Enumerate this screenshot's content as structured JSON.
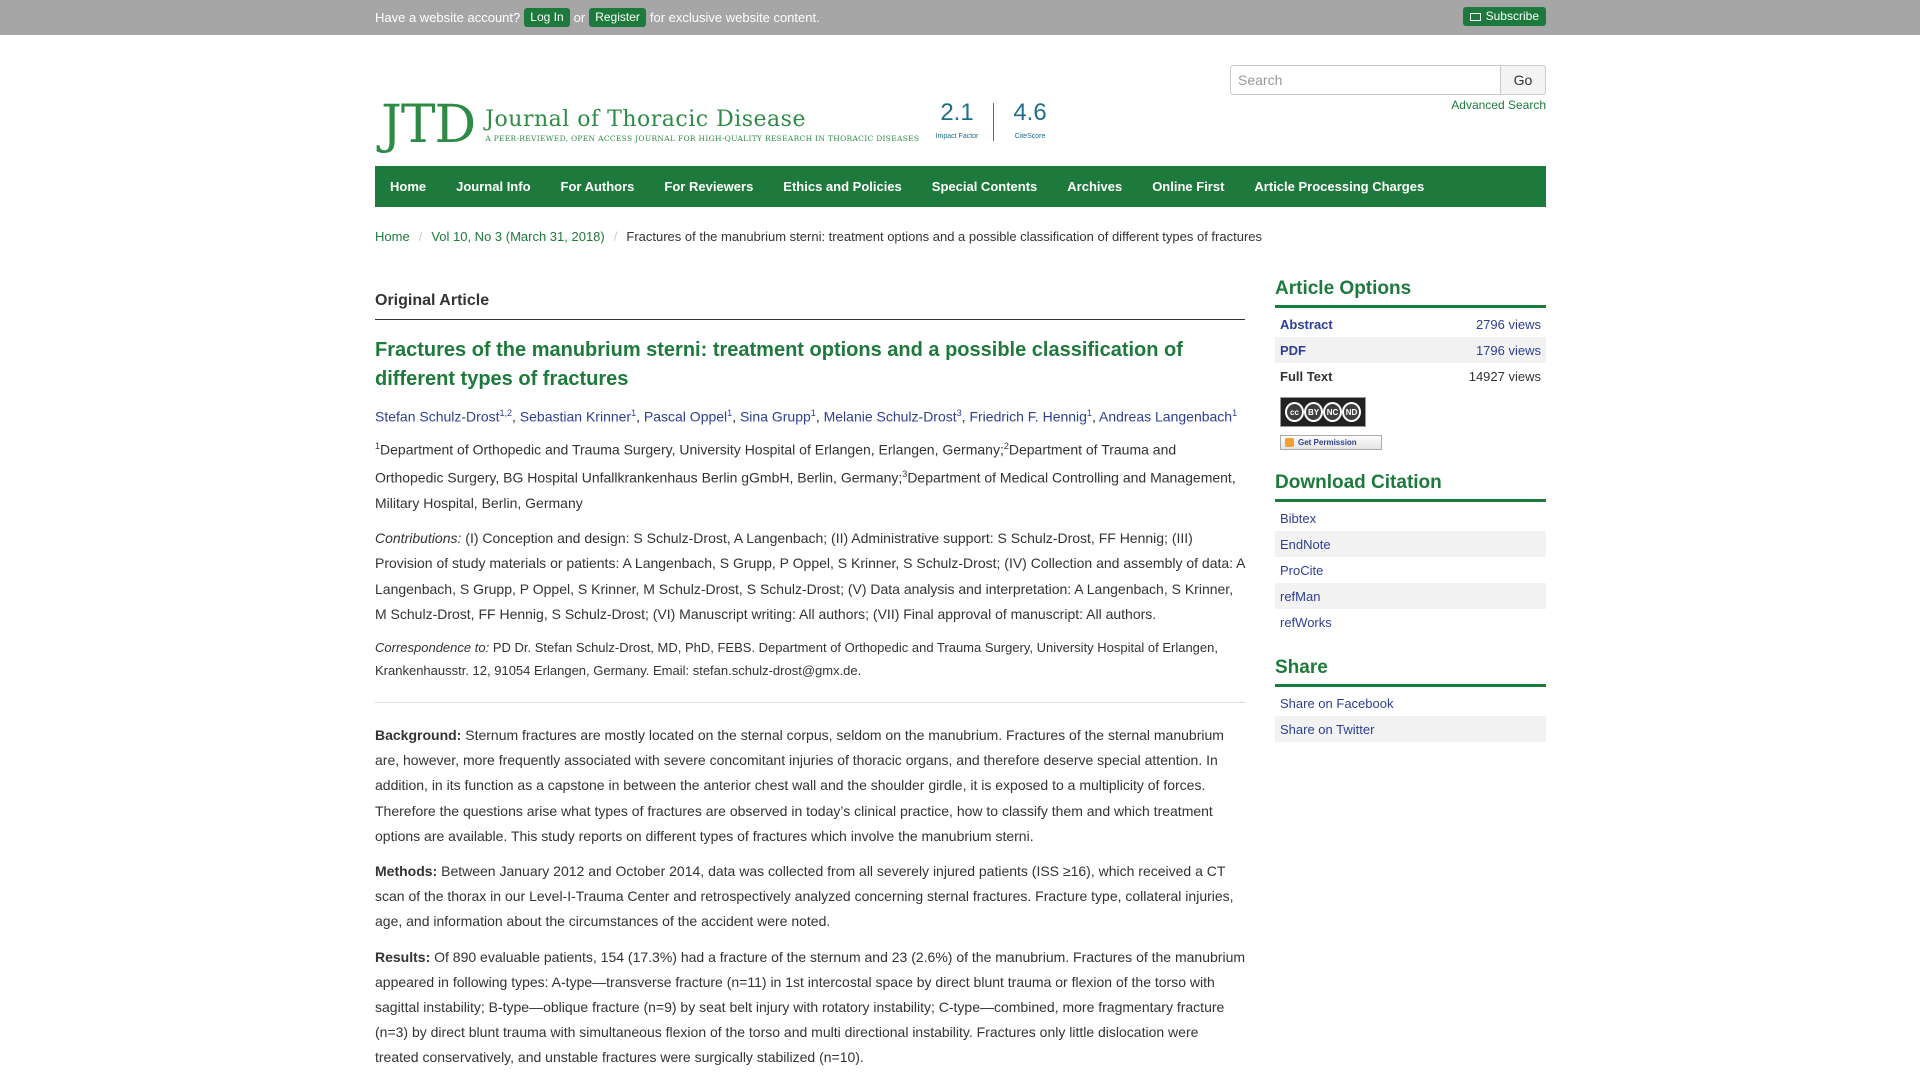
{
  "topbar": {
    "prompt": "Have a website account?",
    "login": "Log In",
    "or": "or",
    "register": "Register",
    "suffix": "for exclusive website content.",
    "subscribe": "Subscribe"
  },
  "header": {
    "logo_mark": "JTD",
    "logo_title": "Journal of Thoracic Disease",
    "logo_subtitle": "A PEER-REVIEWED, OPEN ACCESS JOURNAL FOR HIGH-QUALITY RESEARCH IN THORACIC DISEASES",
    "impact_factor_value": "2.1",
    "impact_factor_label": "Impact Factor",
    "citescore_value": "4.6",
    "citescore_label": "CiteScore",
    "search_placeholder": "Search",
    "search_button": "Go",
    "advanced_search": "Advanced Search"
  },
  "nav": [
    "Home",
    "Journal Info",
    "For Authors",
    "For Reviewers",
    "Ethics and Policies",
    "Special Contents",
    "Archives",
    "Online First",
    "Article Processing Charges"
  ],
  "breadcrumb": {
    "home": "Home",
    "issue": "Vol 10, No 3 (March 31, 2018)",
    "current": "Fractures of the manubrium sterni: treatment options and a possible classification of different types of fractures"
  },
  "article": {
    "section": "Original Article",
    "title": "Fractures of the manubrium sterni: treatment options and a possible classification of different types of fractures",
    "authors": [
      {
        "name": "Stefan Schulz-Drost",
        "sup": "1,2"
      },
      {
        "name": "Sebastian Krinner",
        "sup": "1"
      },
      {
        "name": "Pascal Oppel",
        "sup": "1"
      },
      {
        "name": "Sina Grupp",
        "sup": "1"
      },
      {
        "name": "Melanie Schulz-Drost",
        "sup": "3"
      },
      {
        "name": "Friedrich F. Hennig",
        "sup": "1"
      },
      {
        "name": "Andreas Langenbach",
        "sup": "1"
      }
    ],
    "affiliations": [
      {
        "sup": "1",
        "text": "Department of Orthopedic and Trauma Surgery, University Hospital of Erlangen, Erlangen, Germany;"
      },
      {
        "sup": "2",
        "text": "Department of Trauma and Orthopedic Surgery, BG Hospital Unfallkrankenhaus Berlin gGmbH, Berlin, Germany;"
      },
      {
        "sup": "3",
        "text": "Department of Medical Controlling and Management, Military Hospital, Berlin, Germany"
      }
    ],
    "contributions_label": "Contributions:",
    "contributions_text": "(I) Conception and design: S Schulz-Drost, A Langenbach; (II) Administrative support: S Schulz-Drost, FF Hennig; (III) Provision of study materials or patients: A Langenbach, S Grupp, P Oppel, S Krinner, S Schulz-Drost; (IV) Collection and assembly of data: A Langenbach, S Grupp, P Oppel, S Krinner, M Schulz-Drost, S Schulz-Drost; (V) Data analysis and interpretation: A Langenbach, S Krinner, M Schulz-Drost, FF Hennig, S Schulz-Drost; (VI) Manuscript writing: All authors; (VII) Final approval of manuscript: All authors.",
    "correspondence_label": "Correspondence to:",
    "correspondence_text": "PD Dr. Stefan Schulz-Drost, MD, PhD, FEBS. Department of Orthopedic and Trauma Surgery, University Hospital of Erlangen, Krankenhausstr. 12, 91054 Erlangen, Germany. Email: stefan.schulz-drost@gmx.de.",
    "abstract": {
      "background_label": "Background:",
      "background": "Sternum fractures are mostly located on the sternal corpus, seldom on the manubrium. Fractures of the sternal manubrium are, however, more frequently associated with severe concomitant injuries of thoracic organs, and therefore deserve special attention. In addition, in its function as a capstone in between the anterior chest wall and the shoulder girdle, it is exposed to a multiplicity of forces. Therefore the questions arise what types of fractures are observed in today’s clinical practice, how to classify them and which treatment options are available. This study reports on different types of fractures which involve the manubrium sterni.",
      "methods_label": "Methods:",
      "methods": "Between January 2012 and October 2014, data was collected from all severely injured patients (ISS ≥16), which received a CT scan of the thorax in our Level-I-Trauma Center and retrospectively analyzed concerning sternal fractures. Fracture type, collateral injuries, age, and information about the circumstances of the accident were noted.",
      "results_label": "Results:",
      "results": "Of 890 evaluable patients, 154 (17.3%) had a fracture of the sternum and 23 (2.6%) of the manubrium. Fractures of the manubrium appeared in following types: A-type—transverse fracture (n=11) in 1st intercostal space by direct blunt trauma or flexion of the torso with sagittal instability; B-type—oblique fracture (n=9) by seat belt injury with rotatory instability; C-type—combined, more fragmentary fracture (n=3) by direct blunt trauma with simultaneous flexion of the torso and multi directional instability. Fractures only little dislocation were treated conservatively, and unstable fractures were surgically stabilized (n=10)."
    }
  },
  "sidebar": {
    "article_options_title": "Article Options",
    "options": [
      {
        "name": "Abstract",
        "views": "2796 views"
      },
      {
        "name": "PDF",
        "views": "1796 views"
      },
      {
        "name": "Full Text",
        "views": "14927 views"
      }
    ],
    "license_badge": [
      "cc",
      "BY",
      "NC",
      "ND"
    ],
    "get_permission": "Get Permission",
    "download_citation_title": "Download Citation",
    "citations": [
      "Bibtex",
      "EndNote",
      "ProCite",
      "refMan",
      "refWorks"
    ],
    "share_title": "Share",
    "share": [
      "Share on Facebook",
      "Share on Twitter"
    ]
  },
  "colors": {
    "brand_green": "#1e7a3c",
    "link_blue": "#2d3f93",
    "topbar_gray": "#a6a6a6"
  }
}
